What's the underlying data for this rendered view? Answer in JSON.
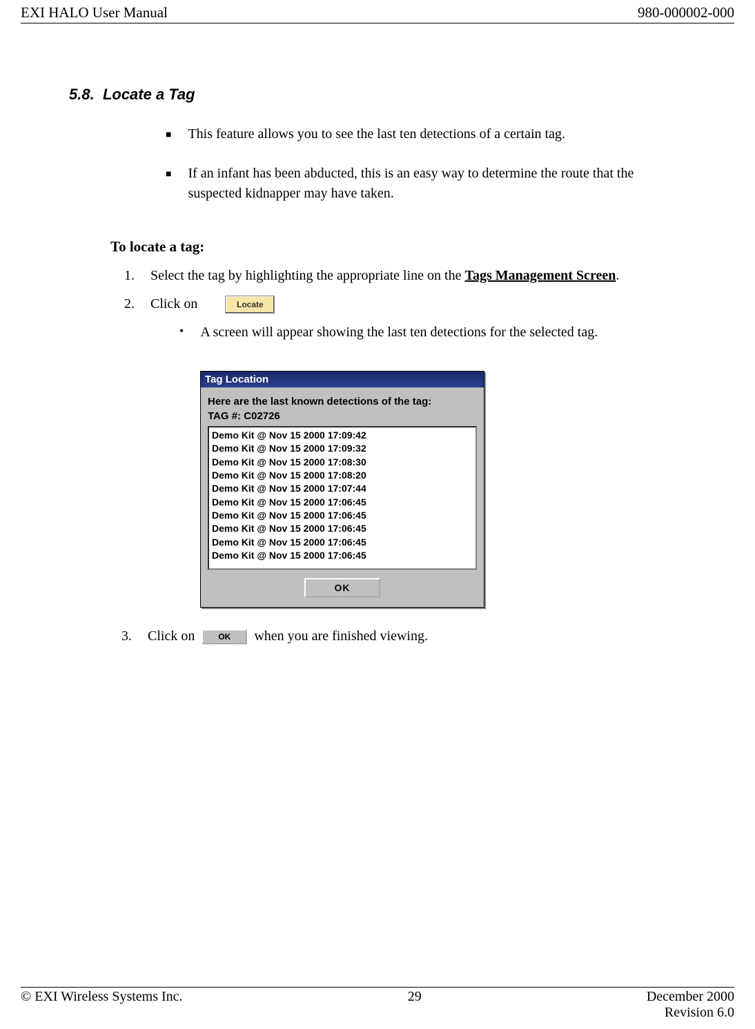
{
  "header": {
    "left": "EXI HALO User Manual",
    "right": "980-000002-000"
  },
  "section": {
    "number": "5.8.",
    "title": "Locate a Tag"
  },
  "intro_bullets": [
    "This feature allows you to see the last ten detections of a certain tag.",
    "If an infant has been abducted, this is an easy way to determine the route that the suspected kidnapper may have taken."
  ],
  "procedure_heading": "To locate a tag:",
  "steps": {
    "s1_num": "1.",
    "s1_text_a": "Select the tag by highlighting the appropriate line on the ",
    "s1_text_b": "Tags Management Screen",
    "s1_text_c": ".",
    "s2_num": "2.",
    "s2_text": "Click on",
    "locate_btn": "Locate",
    "s2_sub": "A screen will appear showing the last ten detections for the selected tag.",
    "s3_num": "3.",
    "s3_text_a": "Click on",
    "s3_text_b": "when you are finished viewing.",
    "ok_small": "OK"
  },
  "dialog": {
    "title": "Tag Location",
    "line1": "Here are the last known detections of the tag:",
    "line2": "TAG #: C02726",
    "rows": [
      "Demo Kit @ Nov 15 2000 17:09:42",
      "Demo Kit @ Nov 15 2000 17:09:32",
      "Demo Kit @ Nov 15 2000 17:08:30",
      "Demo Kit @ Nov 15 2000 17:08:20",
      "Demo Kit @ Nov 15 2000 17:07:44",
      "Demo Kit @ Nov 15 2000 17:06:45",
      "Demo Kit @ Nov 15 2000 17:06:45",
      "Demo Kit @ Nov 15 2000 17:06:45",
      "Demo Kit @ Nov 15 2000 17:06:45",
      "Demo Kit @ Nov 15 2000 17:06:45"
    ],
    "ok": "OK"
  },
  "footer": {
    "left": "© EXI Wireless Systems Inc.",
    "center": "29",
    "right1": "December 2000",
    "right2": "Revision 6.0"
  }
}
